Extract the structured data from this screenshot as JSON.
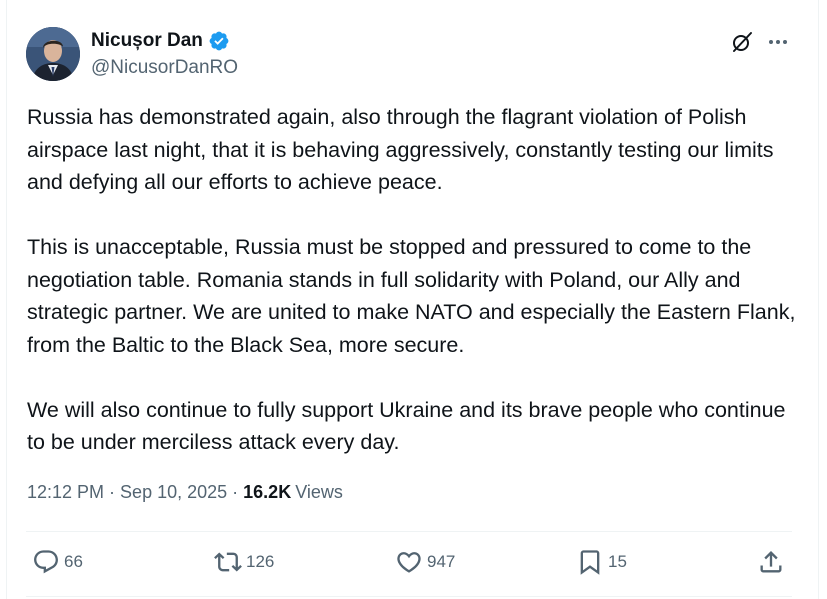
{
  "author": {
    "name": "Nicușor Dan",
    "handle": "@NicusorDanRO"
  },
  "tweet": {
    "paragraphs": [
      "Russia has demonstrated again, also through the flagrant violation of Polish airspace last night, that it is behaving aggressively, constantly testing our limits and defying all our efforts to achieve peace.",
      "This is unacceptable, Russia must be stopped and pressured to come to the negotiation table. Romania stands in full solidarity with Poland, our Ally and strategic partner. We are united to make NATO and especially the Eastern Flank, from the Baltic to the Black Sea, more secure.",
      "We will also continue to fully support Ukraine and its brave people who continue to be under merciless attack every day."
    ]
  },
  "meta": {
    "time": "12:12 PM",
    "separator": "·",
    "date": "Sep 10, 2025",
    "views_count": "16.2K",
    "views_label": "Views"
  },
  "actions": {
    "replies": "66",
    "reposts": "126",
    "likes": "947",
    "bookmarks": "15"
  },
  "colors": {
    "text": "#0f1419",
    "secondary": "#536471",
    "verified": "#1d9bf0",
    "divider": "#eff3f4"
  },
  "icons": [
    "verified-badge-icon",
    "grok-icon",
    "more-icon",
    "reply-icon",
    "repost-icon",
    "like-icon",
    "bookmark-icon",
    "share-icon"
  ]
}
